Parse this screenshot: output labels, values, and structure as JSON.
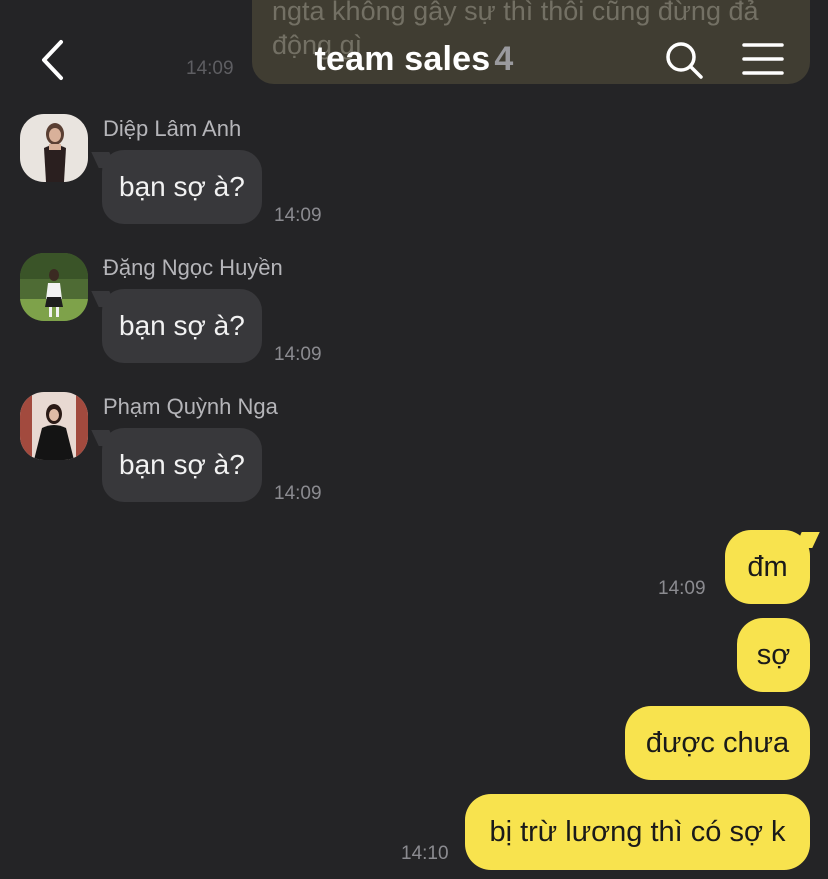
{
  "prev_message": {
    "text": "ngta không gây sự thì thôi cũng đừng đả động gì",
    "time": "14:09"
  },
  "header": {
    "title": "team sales",
    "member_count": "4",
    "back_icon": "chevron-left-icon",
    "search_icon": "search-icon",
    "menu_icon": "hamburger-menu-icon"
  },
  "incoming": [
    {
      "sender": "Diệp Lâm Anh",
      "text": "bạn sợ à?",
      "time": "14:09"
    },
    {
      "sender": "Đặng Ngọc Huyền",
      "text": "bạn sợ à?",
      "time": "14:09"
    },
    {
      "sender": "Phạm Quỳnh Nga",
      "text": "bạn sợ à?",
      "time": "14:09"
    }
  ],
  "outgoing": [
    {
      "text": "đm",
      "time": "14:09"
    },
    {
      "text": "sợ",
      "time": ""
    },
    {
      "text": "được chưa",
      "time": ""
    },
    {
      "text": "bị trừ lương thì có sợ k",
      "time": "14:10"
    }
  ],
  "colors": {
    "background": "#242426",
    "incoming_bubble": "#38383b",
    "outgoing_bubble": "#f8e34e",
    "timestamp": "#8b8b90"
  }
}
